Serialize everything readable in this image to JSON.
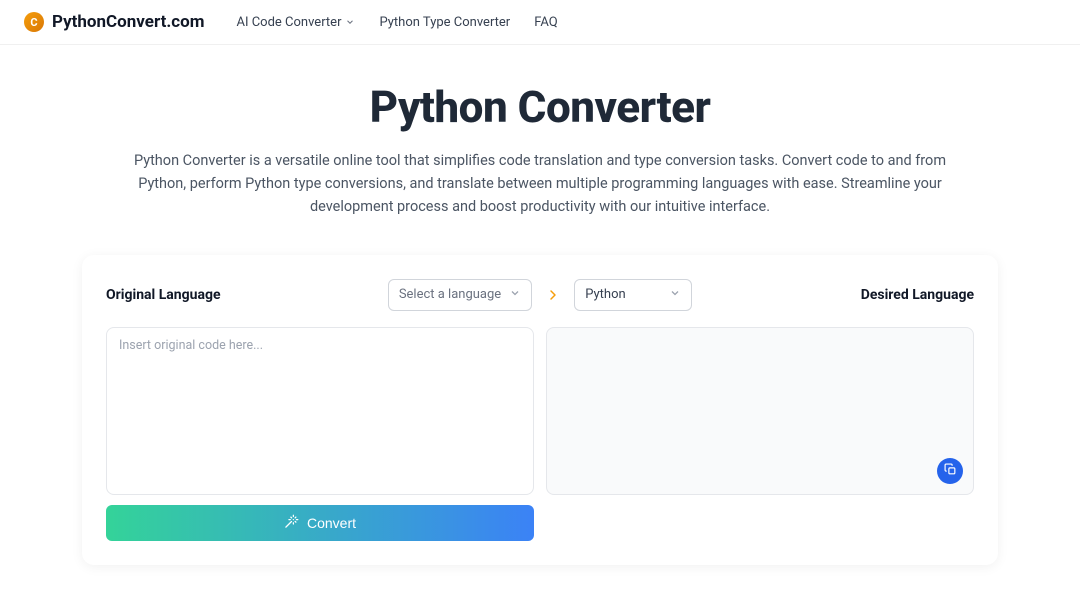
{
  "brand": {
    "logo_letter": "C",
    "name": "PythonConvert.com"
  },
  "nav": {
    "ai_converter": "AI Code Converter",
    "type_converter": "Python Type Converter",
    "faq": "FAQ"
  },
  "hero": {
    "title": "Python Converter",
    "subtitle": "Python Converter is a versatile online tool that simplifies code translation and type conversion tasks. Convert code to and from Python, perform Python type conversions, and translate between multiple programming languages with ease. Streamline your development process and boost productivity with our intuitive interface."
  },
  "converter": {
    "original_label": "Original Language",
    "desired_label": "Desired Language",
    "source_placeholder": "Select a language",
    "target_value": "Python",
    "input_placeholder": "Insert original code here...",
    "convert_label": "Convert"
  }
}
